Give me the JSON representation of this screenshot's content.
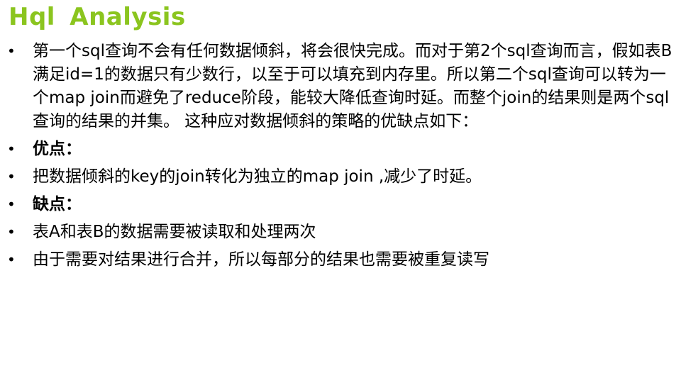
{
  "slide": {
    "title": "Hql  Analysis",
    "bullet_symbol": "•",
    "bullets": [
      {
        "text": "第一个sql查询不会有任何数据倾斜，将会很快完成。而对于第2个sql查询而言，假如表B满足id=1的数据只有少数行，以至于可以填充到内存里。所以第二个sql查询可以转为一个map join而避免了reduce阶段，能较大降低查询时延。而整个join的结果则是两个sql查询的结果的并集。 这种应对数据倾斜的策略的优缺点如下：",
        "bold": false
      },
      {
        "text": "优点：",
        "bold": true
      },
      {
        "text": "把数据倾斜的key的join转化为独立的map join ,减少了时延。",
        "bold": false
      },
      {
        "text": "缺点：",
        "bold": true
      },
      {
        "text": "表A和表B的数据需要被读取和处理两次",
        "bold": false
      },
      {
        "text": "由于需要对结果进行合并，所以每部分的结果也需要被重复读写",
        "bold": false
      }
    ]
  },
  "colors": {
    "title": "#8bc51f",
    "text": "#000000",
    "background": "#ffffff"
  }
}
